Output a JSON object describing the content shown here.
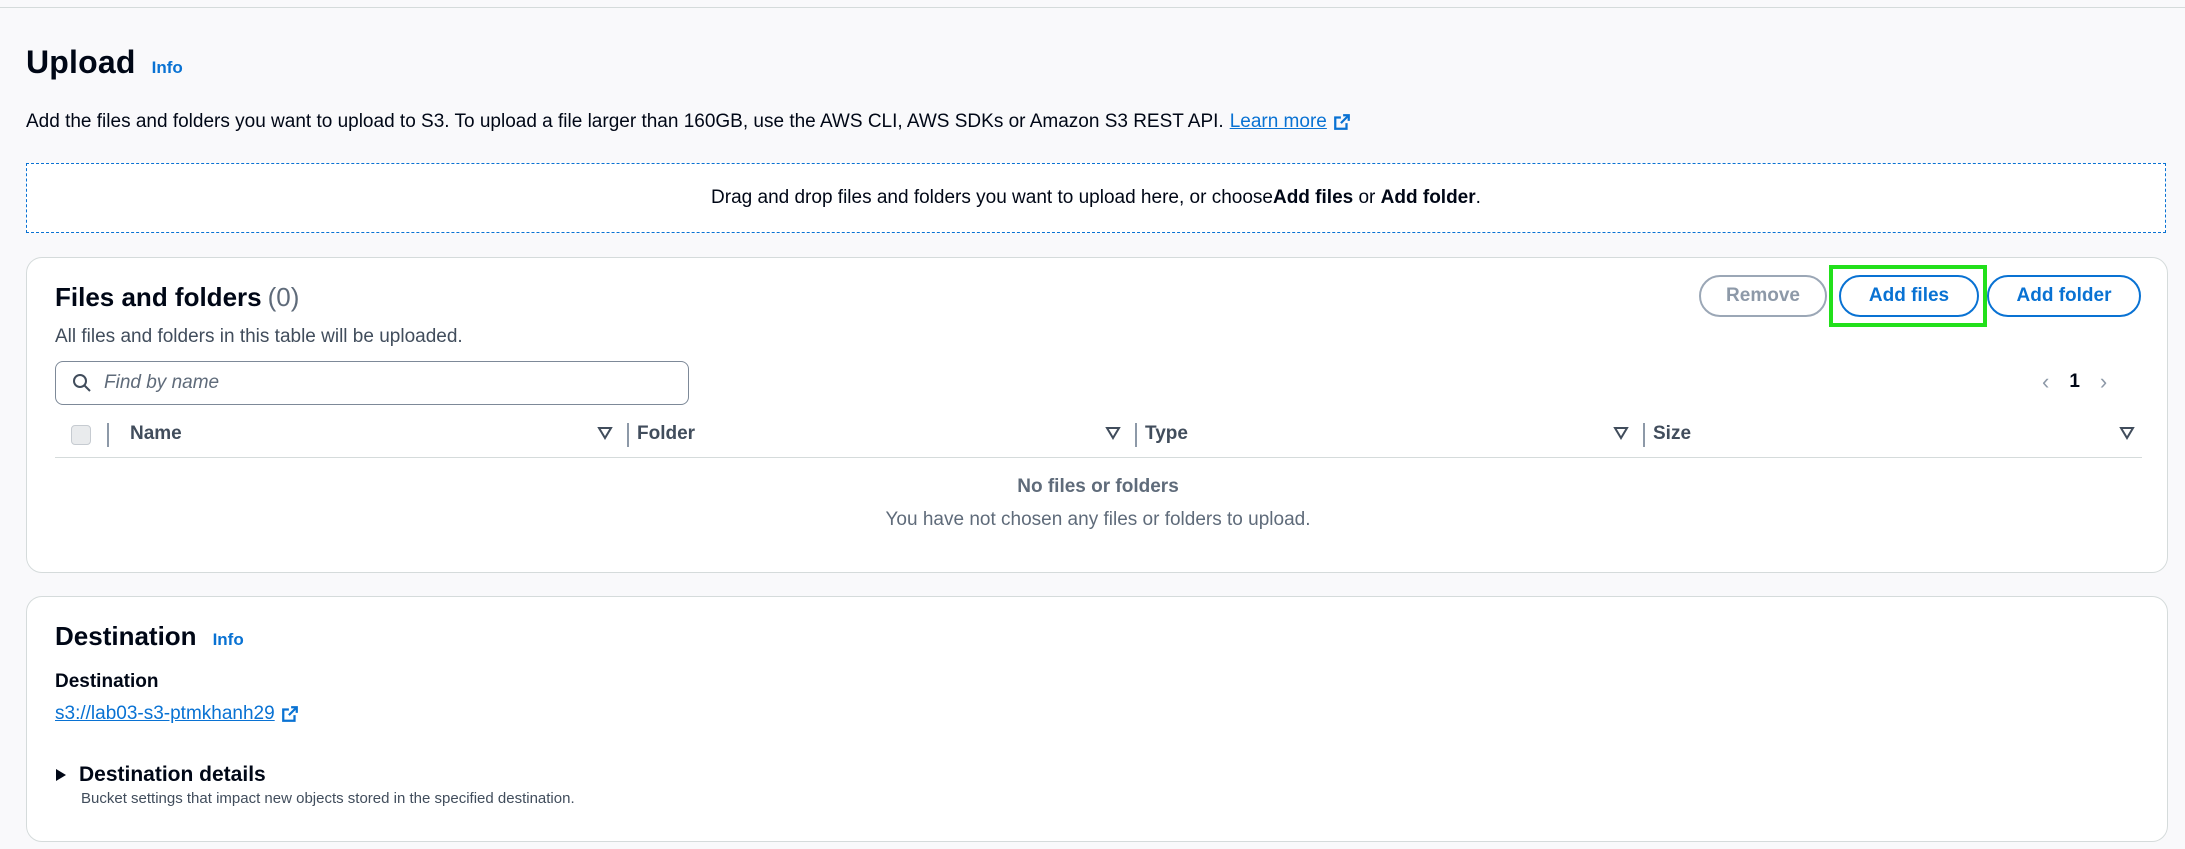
{
  "page": {
    "title": "Upload",
    "info": "Info",
    "description": "Add the files and folders you want to upload to S3. To upload a file larger than 160GB, use the AWS CLI, AWS SDKs or Amazon S3 REST API.",
    "learn_more": "Learn more"
  },
  "dropzone": {
    "text_before": "Drag and drop files and folders you want to upload here, or choose ",
    "add_files": "Add files",
    "or": " or ",
    "add_folder": "Add folder",
    "period": "."
  },
  "files_panel": {
    "title": "Files and folders",
    "count": "(0)",
    "subtitle": "All files and folders in this table will be uploaded.",
    "buttons": {
      "remove": "Remove",
      "add_files": "Add files",
      "add_folder": "Add folder"
    },
    "search_placeholder": "Find by name",
    "page_number": "1",
    "columns": [
      "Name",
      "Folder",
      "Type",
      "Size"
    ],
    "empty_title": "No files or folders",
    "empty_subtitle": "You have not chosen any files or folders to upload."
  },
  "destination": {
    "title": "Destination",
    "info": "Info",
    "label": "Destination",
    "bucket_link": "s3://lab03-s3-ptmkhanh29",
    "details_title": "Destination details",
    "details_description": "Bucket settings that impact new objects stored in the specified destination."
  },
  "colors": {
    "link": "#0972d3",
    "highlight": "#22e01b",
    "border": "#d5dbdb"
  },
  "icons": [
    "search-icon",
    "external-link-icon",
    "chevron-left-icon",
    "chevron-right-icon",
    "sort-icon",
    "caret-right-icon"
  ]
}
